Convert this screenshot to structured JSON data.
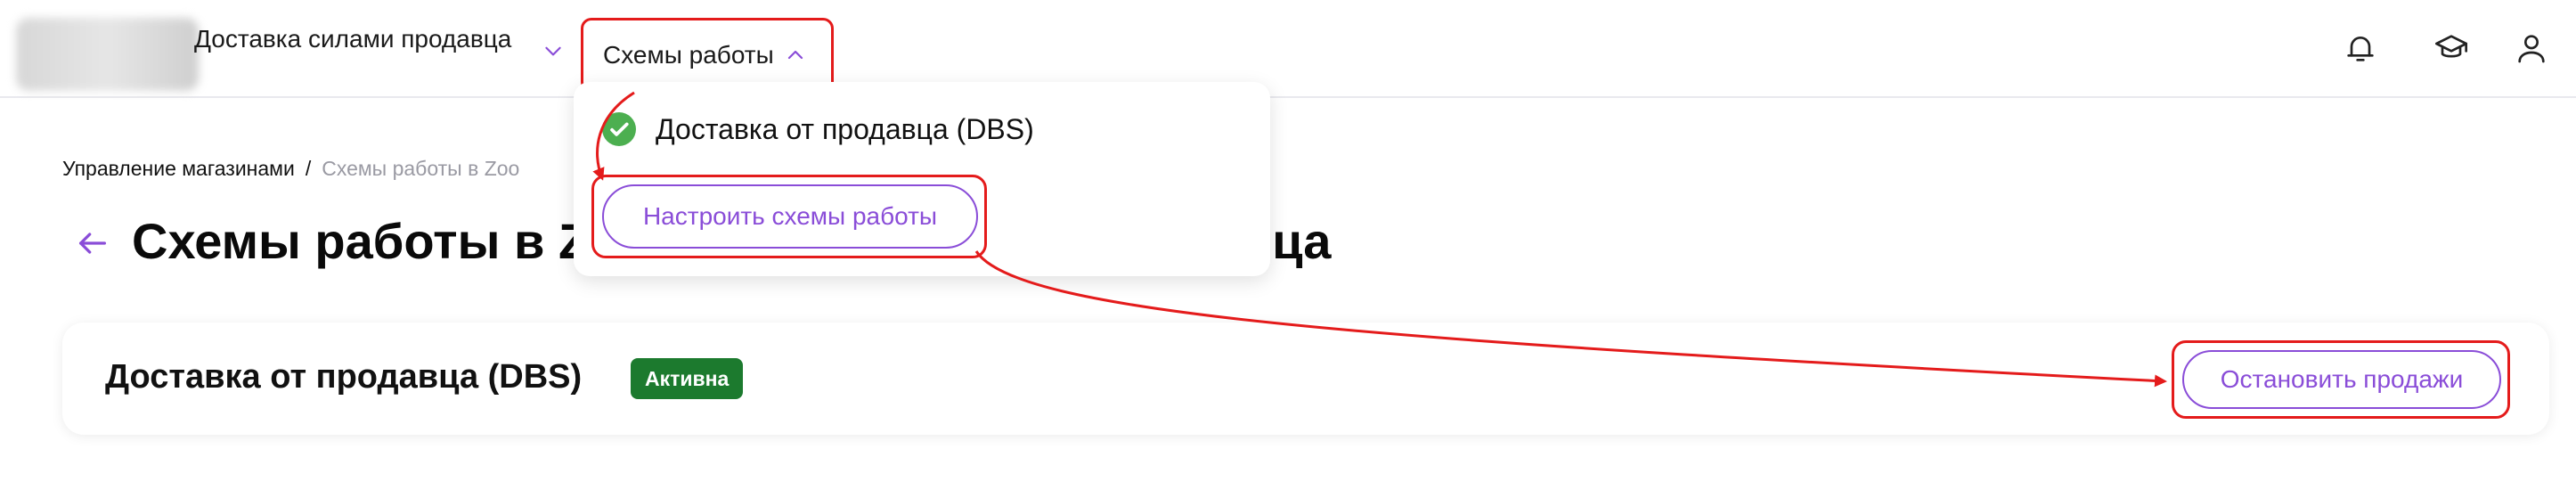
{
  "header": {
    "store_name": "Доставка силами продавца",
    "schemes_label": "Схемы работы",
    "icons": [
      "bell-icon",
      "graduation-cap-icon",
      "user-icon"
    ]
  },
  "dropdown": {
    "item_label": "Доставка от продавца (DBS)",
    "configure_label": "Настроить схемы работы"
  },
  "breadcrumb": {
    "first": "Управление магазинами",
    "separator": "/",
    "second": "Схемы работы в Zoo"
  },
  "page": {
    "title": "Схемы работы в Zoo                          ми продавца"
  },
  "card": {
    "title": "Доставка от продавца (DBS)",
    "badge": "Активна",
    "stop_label": "Остановить продажи"
  },
  "colors": {
    "accent": "#8a4dd8",
    "annotation": "#e41b1b",
    "badge_bg": "#1c7a2e",
    "check": "#4caf50"
  }
}
